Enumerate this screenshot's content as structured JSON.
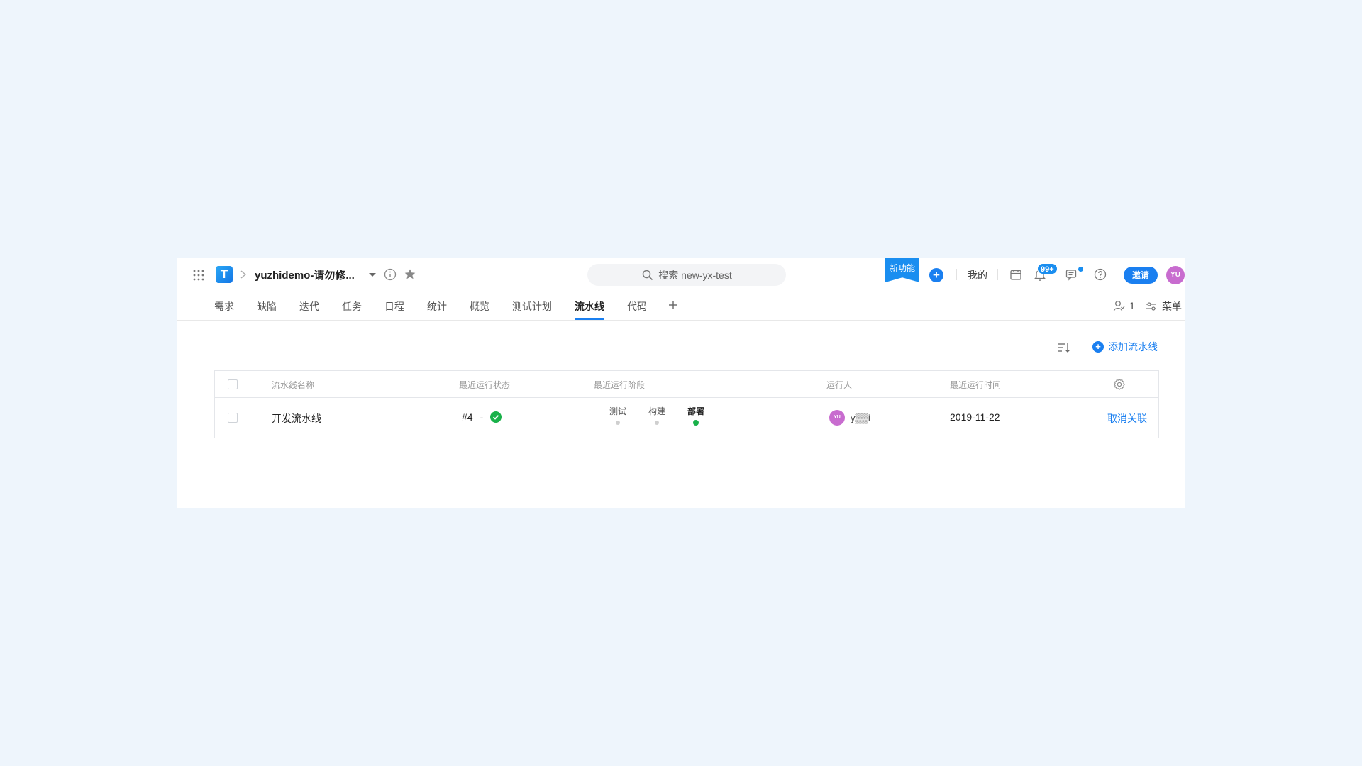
{
  "header": {
    "logo_text": "T",
    "project_name": "yuzhidemo-请勿修...",
    "search_placeholder": "搜索 new-yx-test",
    "new_feature": "新功能",
    "mine": "我的",
    "notification_count": "99+",
    "invite": "邀请",
    "avatar_initials": "YU"
  },
  "tabs": [
    {
      "label": "需求"
    },
    {
      "label": "缺陷"
    },
    {
      "label": "迭代"
    },
    {
      "label": "任务"
    },
    {
      "label": "日程"
    },
    {
      "label": "统计"
    },
    {
      "label": "概览"
    },
    {
      "label": "测试计划"
    },
    {
      "label": "流水线",
      "active": true
    },
    {
      "label": "代码"
    }
  ],
  "tabbar_right": {
    "member_count": "1",
    "menu": "菜单"
  },
  "toolbar": {
    "add_pipeline": "添加流水线"
  },
  "table": {
    "columns": [
      "流水线名称",
      "最近运行状态",
      "最近运行阶段",
      "运行人",
      "最近运行时间"
    ],
    "rows": [
      {
        "name": "开发流水线",
        "run_number": "#4",
        "run_separator": "-",
        "status": "success",
        "stages": [
          "测试",
          "构建",
          "部署"
        ],
        "current_stage": "部署",
        "runner_initials": "YU",
        "runner_name": "y▒▒i",
        "last_run_time": "2019-11-22",
        "action": "取消关联"
      }
    ]
  },
  "colors": {
    "primary": "#1a7ff0",
    "success": "#19b14a",
    "avatar": "#c86ccf",
    "background": "#eef5fc"
  }
}
